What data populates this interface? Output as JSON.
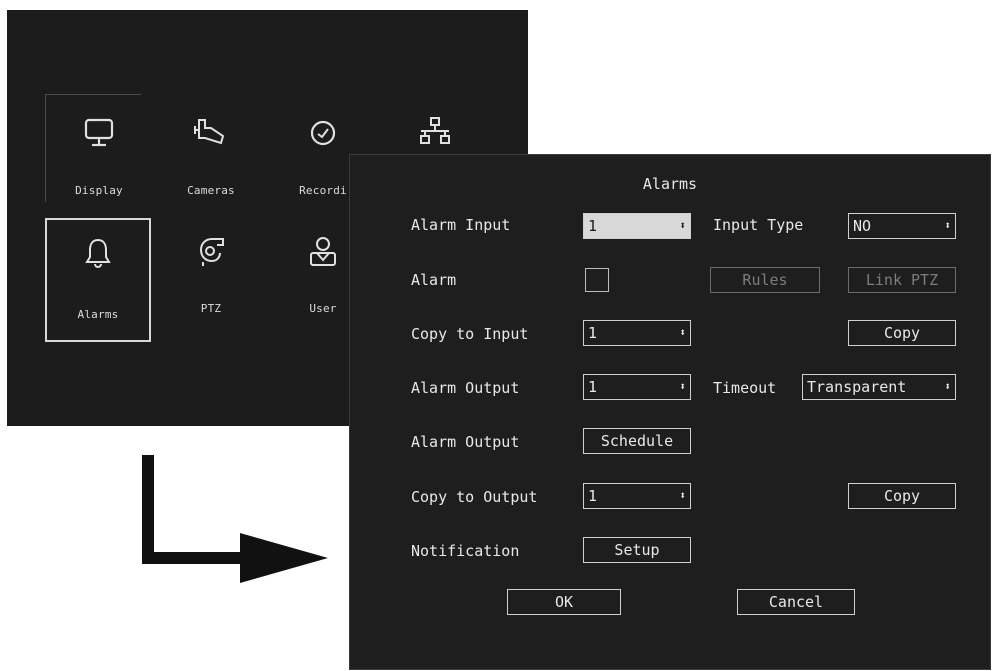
{
  "menu": {
    "items": [
      {
        "label": "Display",
        "icon": "monitor-icon"
      },
      {
        "label": "Cameras",
        "icon": "camera-icon"
      },
      {
        "label": "Recordi",
        "icon": "clock-icon"
      },
      {
        "label": "",
        "icon": "network-icon"
      },
      {
        "label": "Alarms",
        "icon": "bell-icon",
        "selected": true
      },
      {
        "label": "PTZ",
        "icon": "ptz-camera-icon"
      },
      {
        "label": "User",
        "icon": "user-icon"
      }
    ]
  },
  "dialog": {
    "title": "Alarms",
    "alarm_input": {
      "label": "Alarm Input",
      "value": "1"
    },
    "input_type": {
      "label": "Input Type",
      "value": "NO"
    },
    "alarm": {
      "label": "Alarm",
      "rules_label": "Rules",
      "link_ptz_label": "Link PTZ"
    },
    "copy_to_input": {
      "label": "Copy to Input",
      "value": "1",
      "button": "Copy"
    },
    "alarm_output": {
      "label": "Alarm Output",
      "value": "1"
    },
    "timeout": {
      "label": "Timeout",
      "value": "Transparent"
    },
    "alarm_output_schedule": {
      "label": "Alarm Output",
      "button": "Schedule"
    },
    "copy_to_output": {
      "label": "Copy to Output",
      "value": "1",
      "button": "Copy"
    },
    "notification": {
      "label": "Notification",
      "button": "Setup"
    },
    "ok_label": "OK",
    "cancel_label": "Cancel"
  },
  "colors": {
    "panel_bg": "#1c1c1c",
    "dialog_bg": "#1e1e1e",
    "text": "#e8e8e8",
    "highlight": "#d8d8d8",
    "disabled": "#7d7d7d"
  }
}
